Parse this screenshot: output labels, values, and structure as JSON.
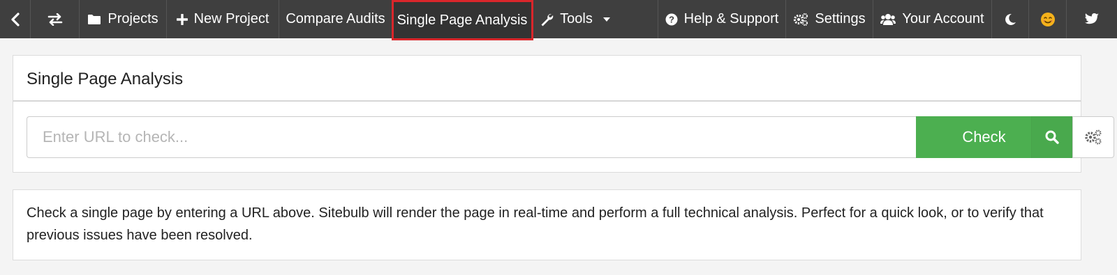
{
  "nav": {
    "back_icon": "chevron-left-icon",
    "switch_icon": "exchange-icon",
    "projects_label": "Projects",
    "new_project_label": "New Project",
    "compare_audits_label": "Compare Audits",
    "single_page_label": "Single Page Analysis",
    "tools_label": "Tools",
    "help_label": "Help & Support",
    "settings_label": "Settings",
    "account_label": "Your Account",
    "dark_mode_icon": "moon-icon",
    "emoji_icon": "smiley-icon",
    "twitter_icon": "twitter-icon"
  },
  "page": {
    "title": "Single Page Analysis",
    "url_placeholder": "Enter URL to check...",
    "url_value": "",
    "check_label": "Check",
    "description": "Check a single page by entering a URL above. Sitebulb will render the page in real-time and perform a full technical analysis. Perfect for a quick look, or to verify that previous issues have been resolved."
  },
  "colors": {
    "nav_bg": "#3f3f3f",
    "active_outline": "#d9262b",
    "check_green": "#4caf50",
    "emoji_yellow": "#f5b21b"
  }
}
